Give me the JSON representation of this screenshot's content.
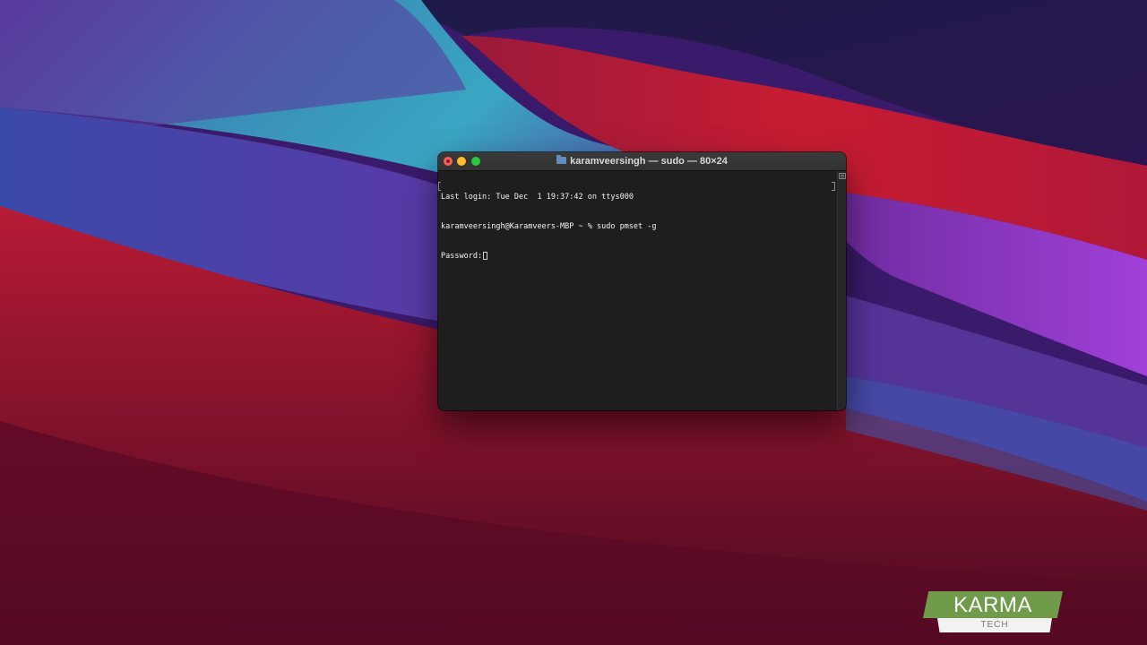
{
  "window": {
    "title": "karamveersingh — sudo — 80×24"
  },
  "terminal": {
    "lines": [
      "Last login: Tue Dec  1 19:37:42 on ttys000",
      "karamveersingh@Karamveers-MBP ~ % sudo pmset -g",
      "Password:"
    ]
  },
  "logo": {
    "name": "KARMA",
    "sub": "TECH"
  },
  "colors": {
    "close": "#fe5f57",
    "minimize": "#febc2e",
    "maximize": "#28c840",
    "terminal_bg": "#1e1e1e",
    "logo_green": "#6f9b4a"
  },
  "icons": {
    "folder": "folder-icon",
    "scroll": "scrollback-icon"
  }
}
